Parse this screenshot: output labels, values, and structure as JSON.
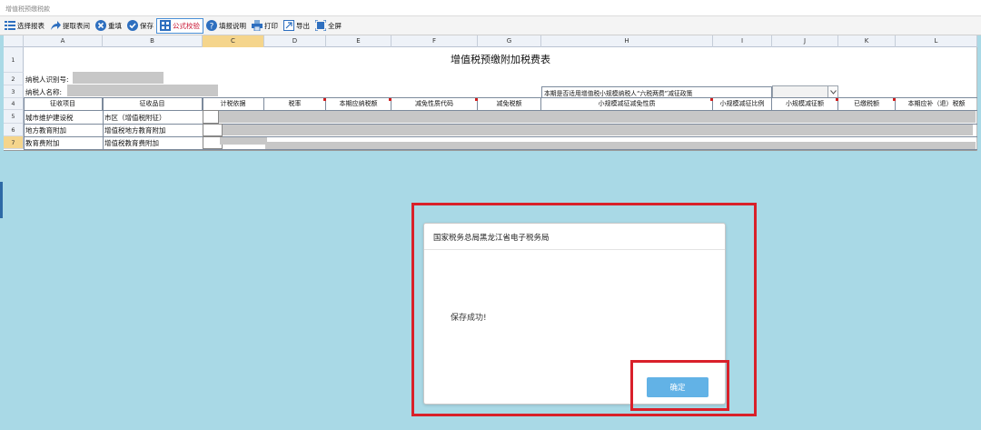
{
  "window": {
    "title": "增值税预缴税款"
  },
  "toolbar": {
    "items": [
      {
        "label": "选择报表",
        "icon": "list-icon"
      },
      {
        "label": "提取表间",
        "icon": "share-arrow-icon"
      },
      {
        "label": "重填",
        "icon": "close-circle-icon"
      },
      {
        "label": "保存",
        "icon": "check-circle-icon"
      },
      {
        "label": "公式校验",
        "icon": "formula-icon",
        "active": true
      },
      {
        "label": "填报说明",
        "icon": "help-icon"
      },
      {
        "label": "打印",
        "icon": "printer-icon"
      },
      {
        "label": "导出",
        "icon": "export-icon"
      },
      {
        "label": "全屏",
        "icon": "fullscreen-icon"
      }
    ]
  },
  "sheet": {
    "columns": [
      "A",
      "B",
      "C",
      "D",
      "E",
      "F",
      "G",
      "H",
      "I",
      "J",
      "K",
      "L"
    ],
    "selected_column": "C",
    "rows": [
      "1",
      "2",
      "3",
      "4",
      "5",
      "6",
      "7"
    ],
    "selected_row": "7",
    "title": "增值税预缴附加税费表",
    "taxpayer_id_label": "纳税人识别号:",
    "taxpayer_name_label": "纳税人名称:",
    "policy_label": "本期是否适用增值税小规模纳税人“六税两费”减征政策",
    "headers": [
      "征收项目",
      "征收品目",
      "计税依据",
      "税率",
      "本期应纳税额",
      "减免性质代码",
      "减免税额",
      "小规模减征减免性质",
      "小规模减征比例",
      "小规模减征额",
      "已缴税额",
      "本期应补（退）税额"
    ],
    "data_rows": [
      {
        "item": "城市维护建设税",
        "subitem": "市区（增值税附征）"
      },
      {
        "item": "地方教育附加",
        "subitem": "增值税地方教育附加"
      },
      {
        "item": "教育费附加",
        "subitem": "增值税教育费附加"
      }
    ]
  },
  "dialog": {
    "title": "国家税务总局黑龙江省电子税务局",
    "message": "保存成功!",
    "ok_label": "确定"
  },
  "colors": {
    "background": "#a9d9e6",
    "highlight_frame": "#d9202a",
    "ok_button": "#62b2e6",
    "selected_header": "#f5d58c"
  }
}
